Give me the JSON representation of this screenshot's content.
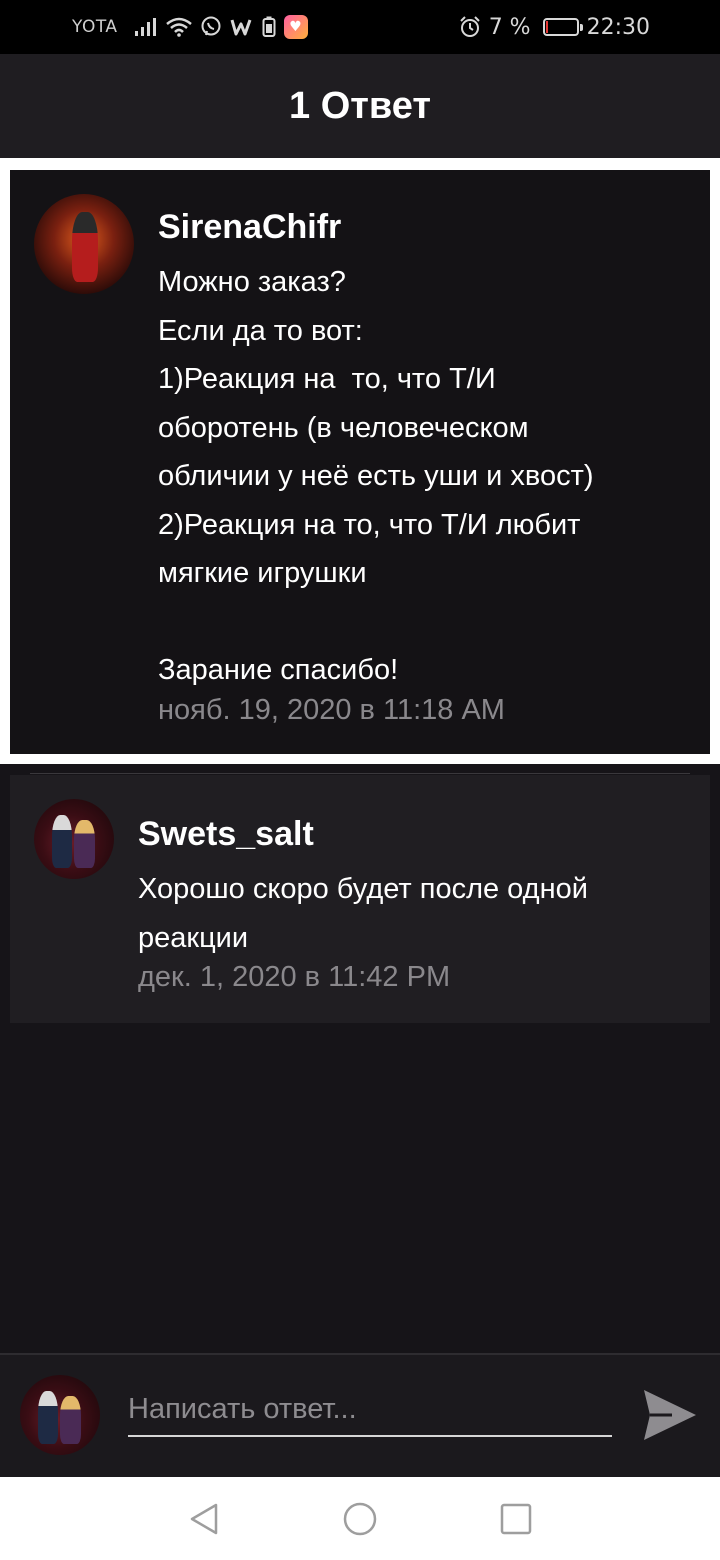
{
  "status_bar": {
    "carrier": "YOTA",
    "battery_percent": "7 %",
    "battery_level": 0.07,
    "time": "22:30",
    "icons": [
      "signal-icon",
      "wifi-icon",
      "viber-icon",
      "wattpad-icon",
      "battery-saver-icon",
      "heart-app-icon",
      "alarm-icon",
      "battery-icon"
    ]
  },
  "header": {
    "title": "1 Ответ"
  },
  "parent_comment": {
    "author": "SirenaChifr",
    "text": "Можно заказ?\nЕсли да то вот:\n1)Реакция на  то, что Т/И\nоборотень (в человеческом\nобличии у неё есть уши и хвост)\n2)Реакция на то, что Т/И любит\nмягкие игрушки\n\nЗарание спасибо!",
    "timestamp": "нояб. 19, 2020 в 11:18 AM"
  },
  "reply": {
    "author": "Swets_salt",
    "text": "Хорошо скоро будет после одной\nреакции",
    "timestamp": "дек. 1, 2020 в 11:42 PM"
  },
  "composer": {
    "placeholder": "Написать ответ..."
  },
  "nav": {
    "icons": [
      "back-icon",
      "home-icon",
      "recents-icon"
    ]
  },
  "colors": {
    "background": "#161418",
    "card": "#141215",
    "reply_card": "#201e22",
    "timestamp": "#8a888c"
  }
}
